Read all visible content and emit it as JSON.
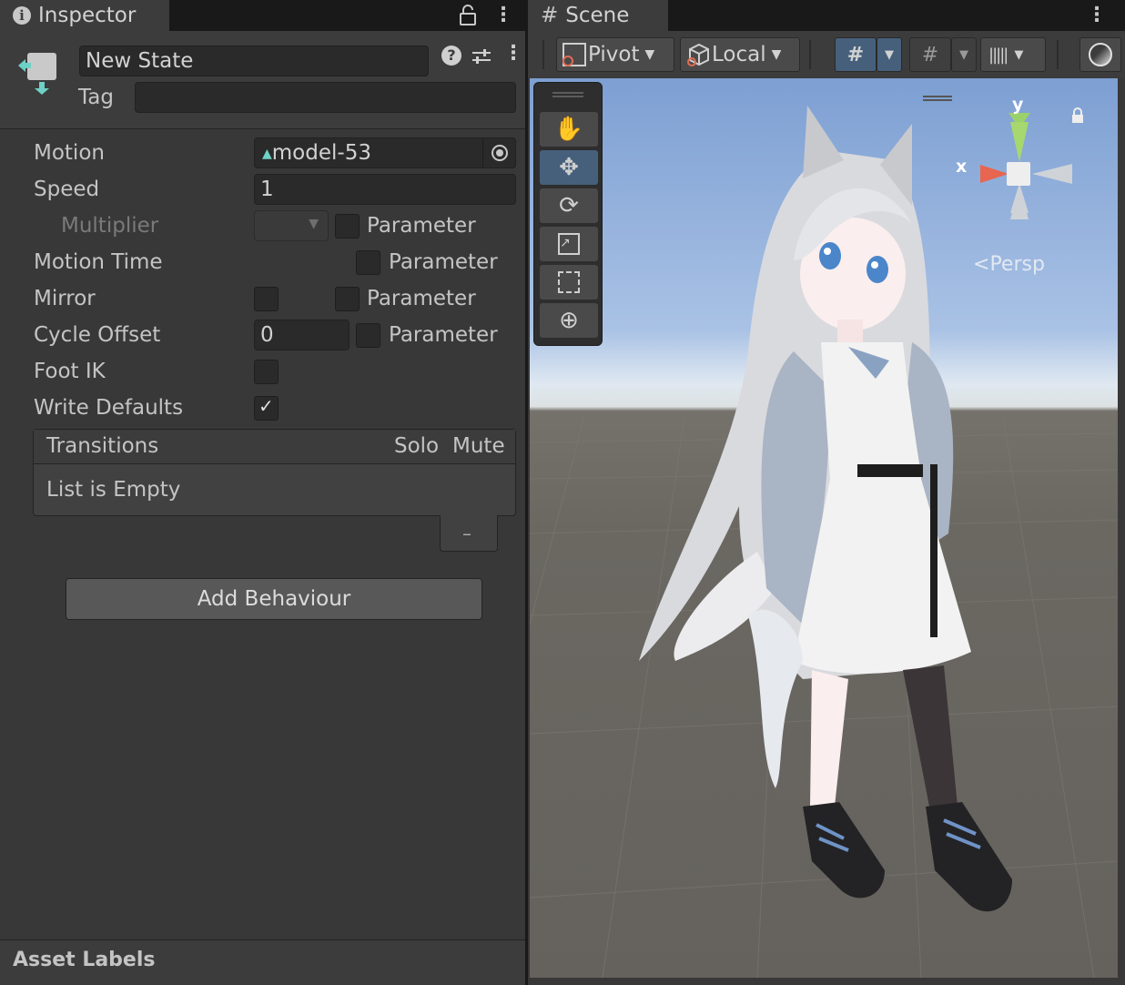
{
  "inspector": {
    "tab_title": "Inspector",
    "state_name": "New State",
    "tag_label": "Tag",
    "tag_value": "",
    "fields": {
      "motion_label": "Motion",
      "motion_value": "model-53",
      "speed_label": "Speed",
      "speed_value": "1",
      "multiplier_label": "Multiplier",
      "motion_time_label": "Motion Time",
      "mirror_label": "Mirror",
      "cycle_offset_label": "Cycle Offset",
      "cycle_offset_value": "0",
      "foot_ik_label": "Foot IK",
      "write_defaults_label": "Write Defaults",
      "parameter_label": "Parameter"
    },
    "checkboxes": {
      "multiplier_param": false,
      "motion_time_param": false,
      "mirror": false,
      "mirror_param": false,
      "cycle_offset_param": false,
      "foot_ik": false,
      "write_defaults": true
    },
    "transitions": {
      "header": "Transitions",
      "solo": "Solo",
      "mute": "Mute",
      "empty_text": "List is Empty",
      "minus": "–"
    },
    "add_behaviour": "Add Behaviour",
    "asset_labels": "Asset Labels"
  },
  "scene": {
    "tab_title": "Scene",
    "toolbar": {
      "pivot": "Pivot",
      "local": "Local"
    },
    "gizmo": {
      "y": "y",
      "x": "x",
      "persp": "Persp"
    }
  },
  "colors": {
    "panel_bg": "#383838",
    "accent_active": "#46607c",
    "sky_top": "#7d9fd2",
    "ground": "#6b6862"
  }
}
